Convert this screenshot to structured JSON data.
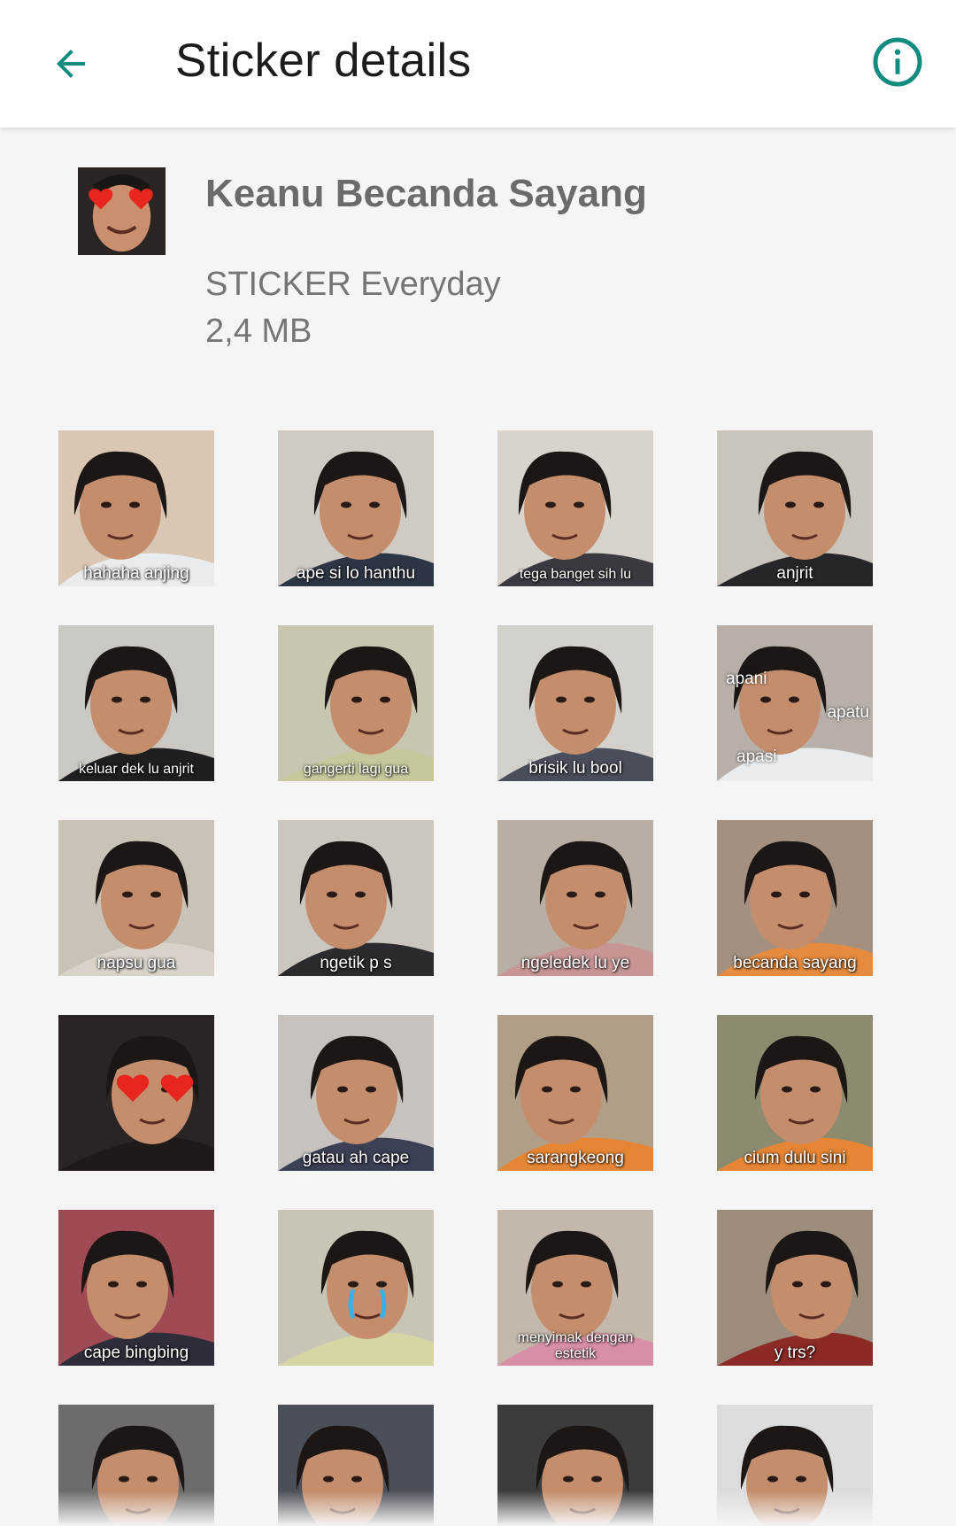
{
  "header": {
    "title": "Sticker details",
    "back_icon": "arrow-back-icon",
    "info_icon": "info-icon",
    "accent_color": "#128C7E"
  },
  "pack": {
    "name": "Keanu Becanda Sayang",
    "publisher": "STICKER Everyday",
    "size": "2,4 MB"
  },
  "stickers": [
    {
      "caption": "hahaha anjing",
      "bg": "#d9c7b4",
      "shirt": "#e9ecef"
    },
    {
      "caption": "ape si lo hanthu",
      "bg": "#cfcac3",
      "shirt": "#2d3644"
    },
    {
      "caption": "tega banget sih lu",
      "bg": "#d8d3cc",
      "shirt": "#3a3a40"
    },
    {
      "caption": "anjrit",
      "bg": "#c9c4bc",
      "shirt": "#26262a"
    },
    {
      "caption": "keluar dek lu anjrit",
      "bg": "#cbc7c2",
      "shirt": "#1f1f22"
    },
    {
      "caption": "gangerti lagi gua",
      "bg": "#c8c6b0",
      "shirt": "#c6c79a"
    },
    {
      "caption": "brisik lu bool",
      "bg": "#d4d0cb",
      "shirt": "#4a4d5a"
    },
    {
      "caption": "apani",
      "caption2": "apatu",
      "caption3": "apasi",
      "bg": "#b8b0a8",
      "shirt": "#e9ecef"
    },
    {
      "caption": "napsu gua",
      "bg": "#c9c2b6",
      "shirt": "#d8d2c8"
    },
    {
      "caption": "ngetik p s",
      "bg": "#cbc6c0",
      "shirt": "#2b2a2e"
    },
    {
      "caption": "ngeledek lu ye",
      "bg": "#b9aea3",
      "shirt": "#c89595"
    },
    {
      "caption": "becanda sayang",
      "bg": "#a39080",
      "shirt": "#e58a3e"
    },
    {
      "caption": "",
      "bg": "#2a2523",
      "shirt": "#1f1a18"
    },
    {
      "caption": "gatau ah cape",
      "bg": "#c7c2bd",
      "shirt": "#3b4055"
    },
    {
      "caption": "sarangkeong",
      "bg": "#b19e86",
      "shirt": "#e68534"
    },
    {
      "caption": "cium dulu sini",
      "bg": "#8c8a6f",
      "shirt": "#e68534"
    },
    {
      "caption": "cape bingbing",
      "bg": "#a04a55",
      "shirt": "#2d2e3a"
    },
    {
      "caption": "",
      "bg": "#c8c4b6",
      "shirt": "#d6d6a4"
    },
    {
      "caption": "menyimak dengan",
      "caption2": "estetik",
      "bg": "#c4b8ad",
      "shirt": "#d88fa5"
    },
    {
      "caption": "y trs?",
      "bg": "#9c8d7c",
      "shirt": "#8c2a26"
    },
    {
      "caption": "",
      "bg": "#6e6b6a",
      "shirt": "#2b2b2b"
    },
    {
      "caption": "",
      "bg": "#4b4f57",
      "shirt": "#303030"
    },
    {
      "caption": "",
      "bg": "#3d3b3c",
      "shirt": "#2a2a2a"
    },
    {
      "caption": "",
      "bg": "#dcdcdc",
      "shirt": "#f3f3f3"
    }
  ]
}
